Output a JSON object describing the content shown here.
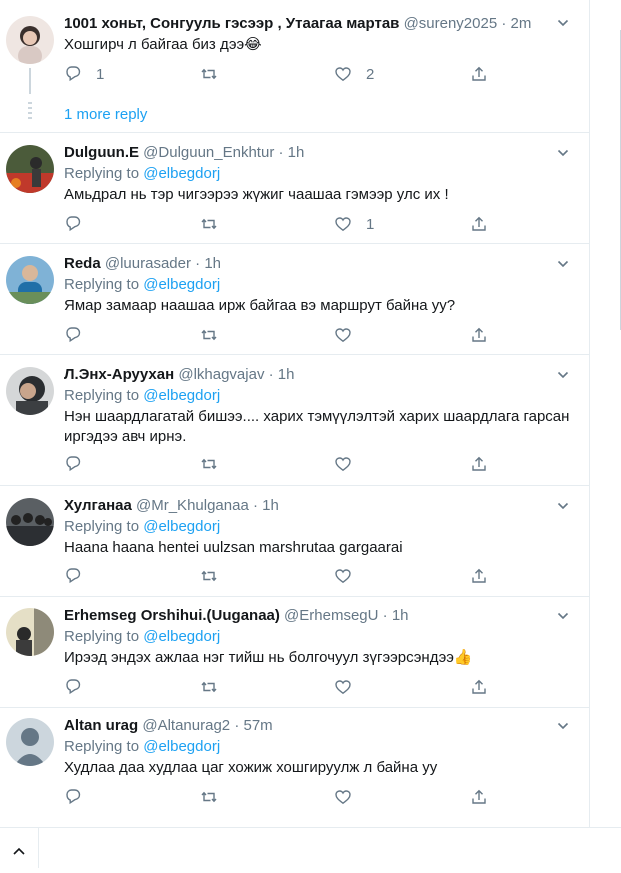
{
  "tweets": [
    {
      "name": "1001 хоньт, Сонгууль гэсээр , Утаагаа мартав",
      "handle": "@sureny2025",
      "time": "2m",
      "replying_to": "",
      "text": "Хошгирч л байгаа биз дээ😂",
      "reply_count": "1",
      "retweet_count": "",
      "like_count": "2",
      "more_replies": "1 more reply"
    },
    {
      "name": "Dulguun.E",
      "handle": "@Dulguun_Enkhtur",
      "time": "1h",
      "replying_to": "@elbegdorj",
      "text": "Амьдрал нь тэр чигээрээ жүжиг чаашаа гэмээр улс их !",
      "reply_count": "",
      "retweet_count": "",
      "like_count": "1"
    },
    {
      "name": "Reda",
      "handle": "@luurasader",
      "time": "1h",
      "replying_to": "@elbegdorj",
      "text": "Ямар замаар наашаа ирж байгаа вэ маршрут байна уу?",
      "reply_count": "",
      "retweet_count": "",
      "like_count": ""
    },
    {
      "name": "Л.Энх-Аруухан",
      "handle": "@lkhagvajav",
      "time": "1h",
      "replying_to": "@elbegdorj",
      "text": "Нэн шаардлагатай бишээ.... харих тэмүүлэлтэй харих шаардлага гарсан иргэдээ авч ирнэ.",
      "reply_count": "",
      "retweet_count": "",
      "like_count": ""
    },
    {
      "name": "Хулганаа",
      "handle": "@Mr_Khulganaa",
      "time": "1h",
      "replying_to": "@elbegdorj",
      "text": "Haana haana hentei uulzsan marshrutaa gargaarai",
      "reply_count": "",
      "retweet_count": "",
      "like_count": ""
    },
    {
      "name": "Erhemseg Orshihui.(Uuganaa)",
      "handle": "@ErhemsegU",
      "time": "1h",
      "replying_to": "@elbegdorj",
      "text": "Ирээд эндэх ажлаа нэг тийш нь болгочуул зүгээрсэндээ👍",
      "reply_count": "",
      "retweet_count": "",
      "like_count": ""
    },
    {
      "name": "Altan urag",
      "handle": "@Altanurag2",
      "time": "57m",
      "replying_to": "@elbegdorj",
      "text": "Худлаа даа худлаа цаг хожиж хошгируулж л байна уу",
      "reply_count": "",
      "retweet_count": "",
      "like_count": ""
    }
  ],
  "labels": {
    "replying_to": "Replying to",
    "separator": "·"
  },
  "colors": {
    "accent": "#1da1f2",
    "muted": "#657786",
    "border": "#e6ecf0"
  },
  "icons": [
    "reply-icon",
    "retweet-icon",
    "like-icon",
    "share-icon",
    "chevron-down-icon",
    "chevron-up-icon"
  ]
}
